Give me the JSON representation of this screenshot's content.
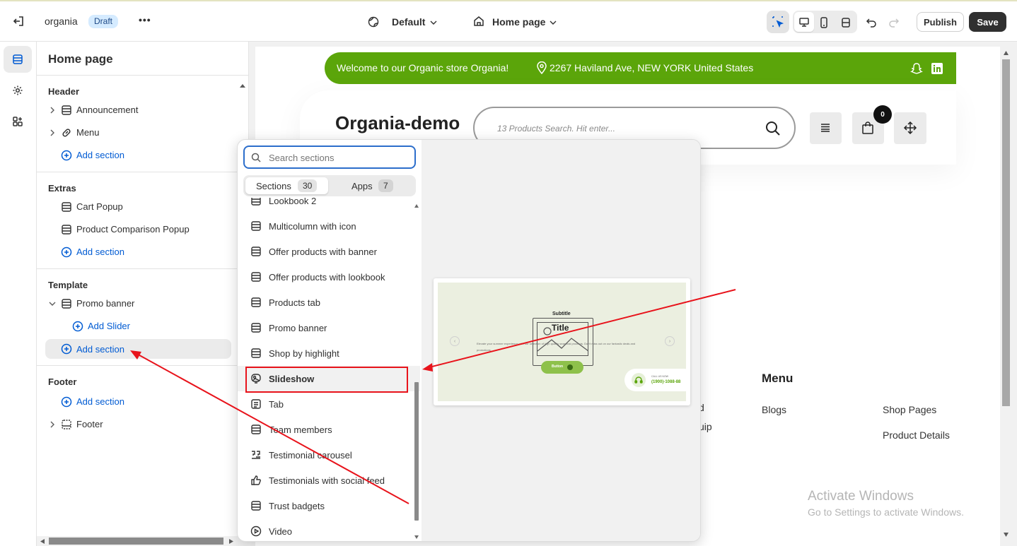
{
  "topbar": {
    "store_name": "organia",
    "status_badge": "Draft",
    "more_label": "•••",
    "theme_selector": "Default",
    "page_selector": "Home page",
    "publish_label": "Publish",
    "save_label": "Save"
  },
  "sidebar": {
    "title": "Home page",
    "groups": {
      "header": {
        "title": "Header",
        "items": [
          "Announcement",
          "Menu"
        ],
        "add": "Add section"
      },
      "extras": {
        "title": "Extras",
        "items": [
          "Cart Popup",
          "Product Comparison Popup"
        ],
        "add": "Add section"
      },
      "template": {
        "title": "Template",
        "items": [
          "Promo banner"
        ],
        "add_slider": "Add Slider",
        "add": "Add section"
      },
      "footer": {
        "title": "Footer",
        "add": "Add section",
        "items": [
          "Footer"
        ]
      }
    }
  },
  "picker": {
    "search_placeholder": "Search sections",
    "tabs": [
      {
        "label": "Sections",
        "count": "30"
      },
      {
        "label": "Apps",
        "count": "7"
      }
    ],
    "partial_item": "Lookbook 2",
    "items": [
      {
        "label": "Multicolumn with icon",
        "icon": "section-icon"
      },
      {
        "label": "Offer products with banner",
        "icon": "section-icon"
      },
      {
        "label": "Offer products with lookbook",
        "icon": "section-icon"
      },
      {
        "label": "Products tab",
        "icon": "section-icon"
      },
      {
        "label": "Promo banner",
        "icon": "section-icon"
      },
      {
        "label": "Shop by highlight",
        "icon": "section-icon"
      },
      {
        "label": "Slideshow",
        "icon": "slideshow-icon"
      },
      {
        "label": "Tab",
        "icon": "text-icon"
      },
      {
        "label": "Team members",
        "icon": "section-icon"
      },
      {
        "label": "Testimonial carousel",
        "icon": "quote-icon"
      },
      {
        "label": "Testimonials with social feed",
        "icon": "thumbs-up-icon"
      },
      {
        "label": "Trust badgets",
        "icon": "section-icon"
      },
      {
        "label": "Video",
        "icon": "play-icon"
      }
    ],
    "selected_item": "Slideshow",
    "preview": {
      "subtitle": "Subtitle",
      "title": "Title",
      "body": "Elevate your summer experience with our selection of high quality seasonal products. Don't miss out on our fantastic deals and promotions.",
      "button": "Button",
      "call_label": "CALL US NOW",
      "phone": "(1900)-1088-88"
    }
  },
  "store": {
    "announcement": "Welcome to our Organic store Organia!",
    "address": "2267 Haviland Ave, NEW YORK United States",
    "logo": "Organia-demo",
    "search_placeholder": "13 Products Search. Hit enter...",
    "cart_count": "0",
    "footer_menu_title": "Menu",
    "footer_links": [
      "Blogs",
      "Shop Pages",
      "Product Details"
    ],
    "partial_text_1": "d",
    "partial_text_2": "uip"
  },
  "watermark": {
    "line1": "Activate Windows",
    "line2": "Go to Settings to activate Windows."
  },
  "colors": {
    "accent_green": "#5ba50a",
    "highlight_red": "#e8131b",
    "link_blue": "#005bd3"
  }
}
